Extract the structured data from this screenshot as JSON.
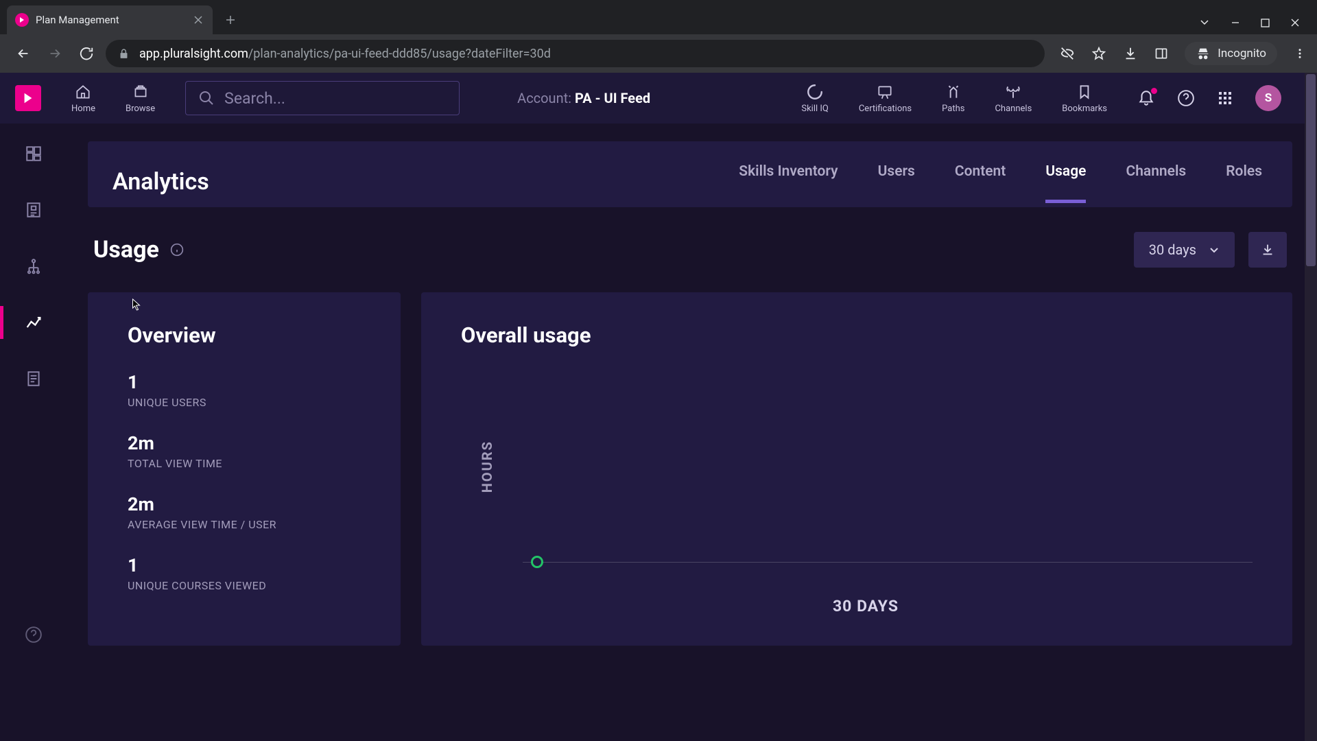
{
  "browser": {
    "tab_title": "Plan Management",
    "url_domain": "app.pluralsight.com",
    "url_path": "/plan-analytics/pa-ui-feed-ddd85/usage?dateFilter=30d",
    "incognito_label": "Incognito"
  },
  "top_nav": {
    "home": "Home",
    "browse": "Browse",
    "search_placeholder": "Search...",
    "account_prefix": "Account: ",
    "account_name": "PA - UI Feed",
    "skill_iq": "Skill IQ",
    "certifications": "Certifications",
    "paths": "Paths",
    "channels": "Channels",
    "bookmarks": "Bookmarks",
    "avatar_letter": "S"
  },
  "analytics": {
    "title": "Analytics",
    "tabs": [
      "Skills Inventory",
      "Users",
      "Content",
      "Usage",
      "Channels",
      "Roles"
    ],
    "active_tab_index": 3
  },
  "usage": {
    "title": "Usage",
    "date_filter": "30 days"
  },
  "overview": {
    "title": "Overview",
    "stats": [
      {
        "value": "1",
        "label": "UNIQUE USERS"
      },
      {
        "value": "2m",
        "label": "TOTAL VIEW TIME"
      },
      {
        "value": "2m",
        "label": "AVERAGE VIEW TIME / USER"
      },
      {
        "value": "1",
        "label": "UNIQUE COURSES VIEWED"
      }
    ]
  },
  "chart": {
    "title": "Overall usage",
    "y_label": "HOURS",
    "x_label": "30 DAYS"
  },
  "chart_data": {
    "type": "line",
    "title": "Overall usage",
    "xlabel": "30 DAYS",
    "ylabel": "HOURS",
    "x": [
      0
    ],
    "values": [
      0
    ]
  }
}
